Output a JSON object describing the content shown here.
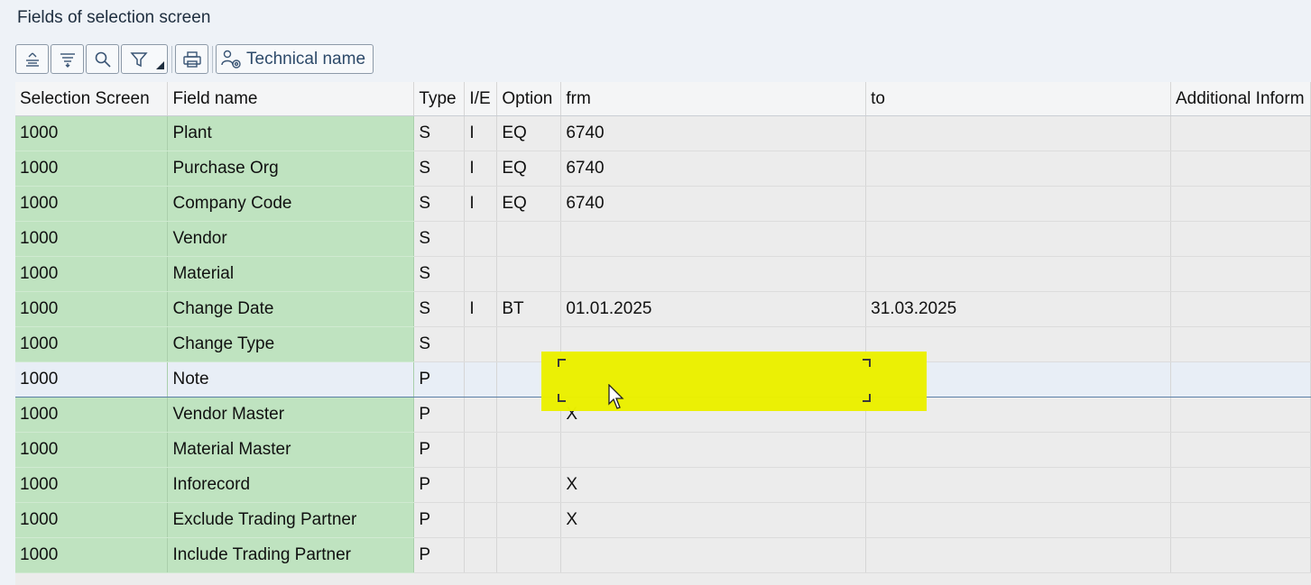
{
  "window": {
    "title": "Fields of selection screen"
  },
  "toolbar": {
    "buttons": [
      {
        "icon": "sort-ascending-icon"
      },
      {
        "icon": "sort-descending-icon"
      },
      {
        "icon": "search-icon"
      },
      {
        "icon": "filter-icon"
      },
      {
        "icon": "print-icon"
      }
    ],
    "technical_name_label": "Technical name"
  },
  "table": {
    "columns": [
      "Selection Screen",
      "Field name",
      "Type",
      "I/E",
      "Option",
      "frm",
      "to",
      "Additional Inform"
    ],
    "rows": [
      {
        "screen": "1000",
        "field": "Plant",
        "type": "S",
        "ie": "I",
        "option": "EQ",
        "from": "6740",
        "to": "",
        "info": ""
      },
      {
        "screen": "1000",
        "field": "Purchase Org",
        "type": "S",
        "ie": "I",
        "option": "EQ",
        "from": "6740",
        "to": "",
        "info": ""
      },
      {
        "screen": "1000",
        "field": "Company Code",
        "type": "S",
        "ie": "I",
        "option": "EQ",
        "from": "6740",
        "to": "",
        "info": ""
      },
      {
        "screen": "1000",
        "field": "Vendor",
        "type": "S",
        "ie": "",
        "option": "",
        "from": "",
        "to": "",
        "info": ""
      },
      {
        "screen": "1000",
        "field": "Material",
        "type": "S",
        "ie": "",
        "option": "",
        "from": "",
        "to": "",
        "info": ""
      },
      {
        "screen": "1000",
        "field": "Change Date",
        "type": "S",
        "ie": "I",
        "option": "BT",
        "from": "01.01.2025",
        "to": "31.03.2025",
        "info": ""
      },
      {
        "screen": "1000",
        "field": "Change Type",
        "type": "S",
        "ie": "",
        "option": "",
        "from": "",
        "to": "",
        "info": ""
      },
      {
        "screen": "1000",
        "field": "Note",
        "type": "P",
        "ie": "",
        "option": "",
        "from": "",
        "to": "",
        "info": "",
        "selected": true
      },
      {
        "screen": "1000",
        "field": "Vendor Master",
        "type": "P",
        "ie": "",
        "option": "",
        "from": "X",
        "to": "",
        "info": ""
      },
      {
        "screen": "1000",
        "field": "Material Master",
        "type": "P",
        "ie": "",
        "option": "",
        "from": "",
        "to": "",
        "info": ""
      },
      {
        "screen": "1000",
        "field": "Inforecord",
        "type": "P",
        "ie": "",
        "option": "",
        "from": "X",
        "to": "",
        "info": ""
      },
      {
        "screen": "1000",
        "field": "Exclude Trading Partner",
        "type": "P",
        "ie": "",
        "option": "",
        "from": "X",
        "to": "",
        "info": ""
      },
      {
        "screen": "1000",
        "field": "Include Trading Partner",
        "type": "P",
        "ie": "",
        "option": "",
        "from": "",
        "to": "",
        "info": ""
      }
    ]
  },
  "colors": {
    "key_column": "#bfe3c0",
    "selected_row": "#e8eef6",
    "highlight": "#ebf000"
  }
}
